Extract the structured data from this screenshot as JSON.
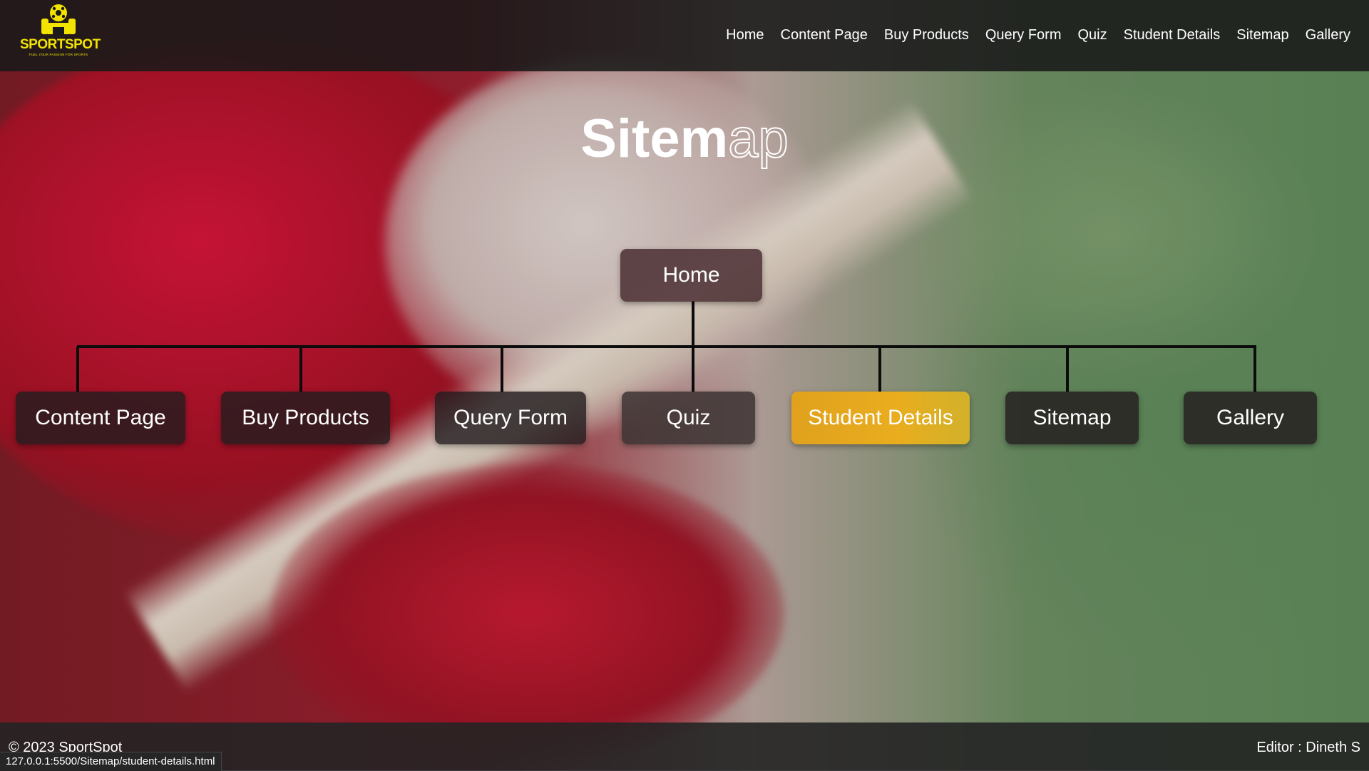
{
  "brand": {
    "name": "SPORTSPOT",
    "tagline": "FUEL YOUR PASSION FOR SPORTS",
    "color": "#f2e400"
  },
  "nav": {
    "items": [
      "Home",
      "Content Page",
      "Buy Products",
      "Query Form",
      "Quiz",
      "Student Details",
      "Sitemap",
      "Gallery"
    ]
  },
  "page": {
    "title_solid": "Sitem",
    "title_outline": "ap"
  },
  "sitemap": {
    "root": "Home",
    "children": [
      "Content Page",
      "Buy Products",
      "Query Form",
      "Quiz",
      "Student Details",
      "Sitemap",
      "Gallery"
    ],
    "highlighted": "Student Details",
    "highlight_color": "#e0a11d"
  },
  "footer": {
    "copyright": "© 2023 SportSpot",
    "editor": "Editor : Dineth S"
  },
  "status_url": "127.0.0.1:5500/Sitemap/student-details.html"
}
